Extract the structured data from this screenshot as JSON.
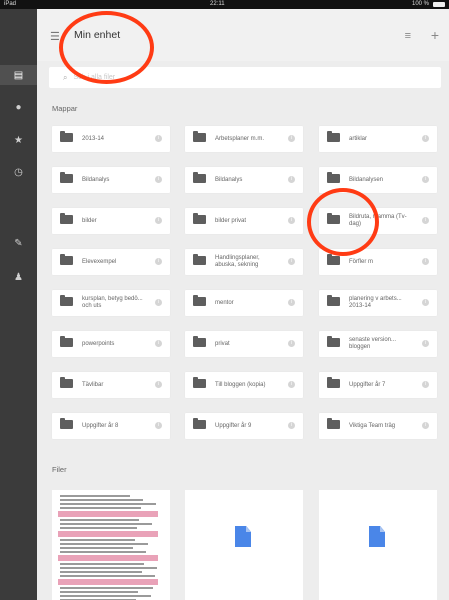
{
  "status_bar": {
    "carrier": "iPad",
    "time": "22:11",
    "battery": "100 %"
  },
  "rail": [
    "drive-icon",
    "shared-icon",
    "star-icon",
    "recent-icon",
    "pin-icon",
    "person-icon"
  ],
  "header": {
    "title": "Min enhet",
    "menu_icon": "menu-icon",
    "list_icon": "list-icon",
    "add_icon": "plus-icon"
  },
  "search": {
    "placeholder": "Sök i alla filer"
  },
  "sections": {
    "folders": "Mappar",
    "files": "Filer"
  },
  "folders": [
    "2013-14",
    "Arbetsplaner m.m.",
    "artiklar",
    "Bildanalys",
    "Bildanalys",
    "Bildanalysen",
    "bilder",
    "bilder privat",
    "Bildruta, mamma (Tv-dag)",
    "Elevexempel",
    "Handlingsplaner, abuska, sekning",
    "Förfler m",
    "kursplan, betyg bedö... och uts",
    "mentor",
    "planering v arbets... 2013-14",
    "powerpoints",
    "privat",
    "senaste version... bloggen",
    "Tävlibar",
    "Till bloggen (kopia)",
    "Uppgifter år 7",
    "Uppgifter år 8",
    "Uppgifter år 9",
    "Viktiga Team träg"
  ],
  "colors": {
    "annotation": "#ff3b14",
    "doc_icon": "#4a86e8",
    "rail": "#3b3b3b"
  }
}
